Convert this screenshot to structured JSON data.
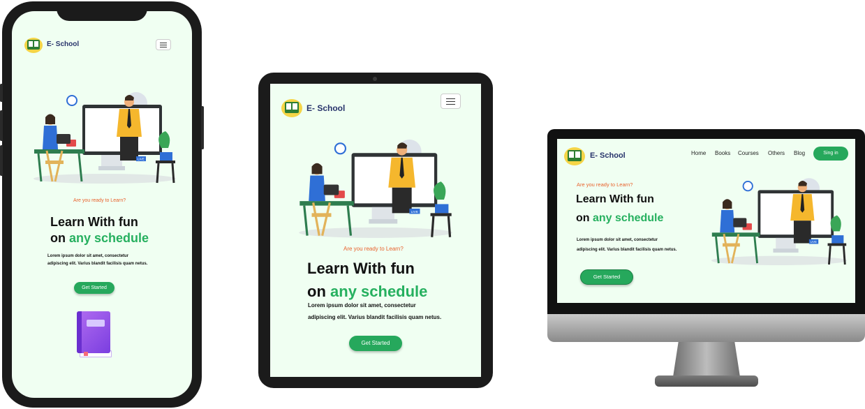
{
  "site": {
    "brand": "E- School",
    "tagline": "Are you ready to Learn?",
    "headline_line1": "Learn With fun",
    "headline_prefix": "on",
    "headline_accent": "any schedule",
    "description_line1": "Lorem ipsum dolor sit amet, consectetur",
    "description_line2": "adipiscing elit. Varius blandit facilisis quam netus.",
    "cta_label": "Get Started",
    "nav": [
      "Home",
      "Books",
      "Courses",
      "Others",
      "Blog"
    ],
    "signin_label": "Sing in",
    "live_label": "LIVE"
  },
  "colors": {
    "background": "#f0fff2",
    "accent_green": "#26b05f",
    "tagline_orange": "#e8612c",
    "brand_navy": "#27336b",
    "device_frame": "#1b1b1b"
  },
  "icons": [
    "logo-book-icon",
    "hamburger-menu-icon",
    "book-icon",
    "clock-icon",
    "heart-icon"
  ]
}
